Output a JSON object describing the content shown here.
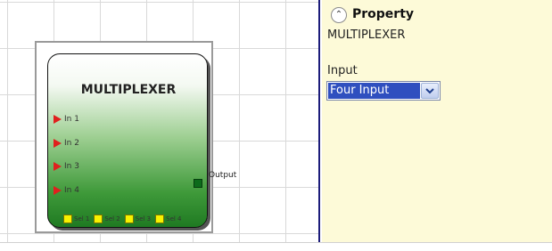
{
  "block": {
    "title": "MULTIPLEXER",
    "inputs": [
      "In 1",
      "In 2",
      "In 3",
      "In 4"
    ],
    "output": "Output",
    "selectors": [
      "Sel 1",
      "Sel 2",
      "Sel 3",
      "Sel 4"
    ]
  },
  "panel": {
    "heading": "Property",
    "block_name": "MULTIPLEXER",
    "input_label": "Input",
    "input_value": "Four Input",
    "collapse_icon": "chevron-up-icon",
    "dropdown_icon": "chevron-down-icon"
  },
  "colors": {
    "panel_bg": "#fdfad8",
    "input_pin": "#e0201e",
    "output_pin": "#0d6b1b",
    "selector_pin": "#f7f200",
    "selection": "#2f4fbf"
  }
}
